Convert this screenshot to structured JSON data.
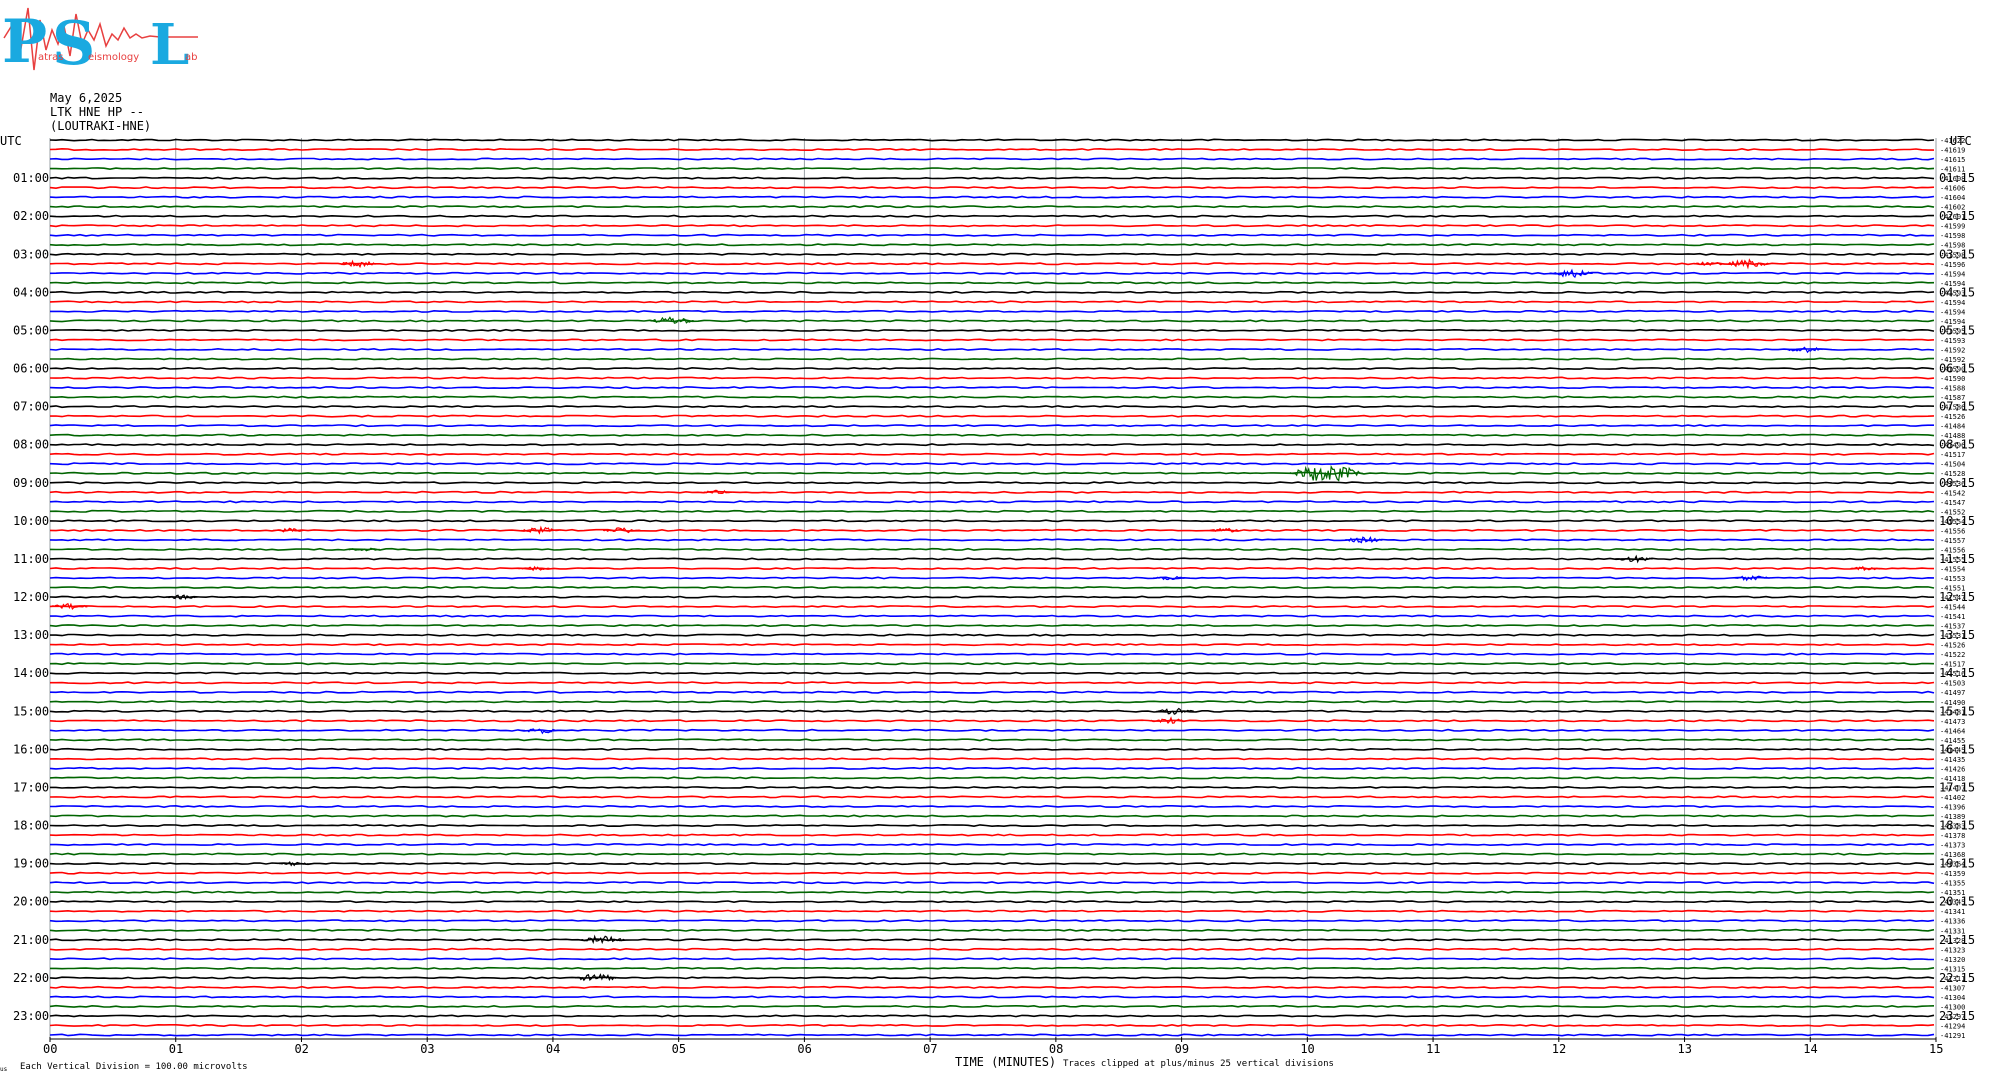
{
  "header": {
    "logo": {
      "name": "Patras Seismology Lab",
      "letters": [
        "P",
        "S",
        "L"
      ],
      "caption_words": [
        "atras",
        "eismology",
        "ab"
      ]
    },
    "date": "May 6,2025",
    "channel": "LTK HNE HP --",
    "station": "(LOUTRAKI-HNE)"
  },
  "chart_data": {
    "type": "line",
    "title": "",
    "xlabel": "TIME (MINUTES)",
    "x_ticks": [
      "00",
      "01",
      "02",
      "03",
      "04",
      "05",
      "06",
      "07",
      "08",
      "09",
      "10",
      "11",
      "12",
      "13",
      "14",
      "15"
    ],
    "xlim": [
      0,
      15
    ],
    "left_axis_label": "UTC",
    "right_axis_label": "UTC",
    "left_hour_labels": [
      "01:00",
      "02:00",
      "03:00",
      "04:00",
      "05:00",
      "06:00",
      "07:00",
      "08:00",
      "09:00",
      "10:00",
      "11:00",
      "12:00",
      "13:00",
      "14:00",
      "15:00",
      "16:00",
      "17:00",
      "18:00",
      "19:00",
      "20:00",
      "21:00",
      "22:00",
      "23:00"
    ],
    "right_hour_labels": [
      "01:15",
      "02:15",
      "03:15",
      "04:15",
      "05:15",
      "06:15",
      "07:15",
      "08:15",
      "09:15",
      "10:15",
      "11:15",
      "12:15",
      "13:15",
      "14:15",
      "15:15",
      "16:15",
      "17:15",
      "18:15",
      "19:15",
      "20:15",
      "21:15",
      "22:15",
      "23:15"
    ],
    "trace_color_cycle": [
      "#000000",
      "#ff0000",
      "#0000ff",
      "#006400"
    ],
    "trace_offsets": [
      "-41622",
      "-41619",
      "-41615",
      "-41611",
      "-41608",
      "-41606",
      "-41604",
      "-41602",
      "-41601",
      "-41599",
      "-41598",
      "-41598",
      "-41598",
      "-41596",
      "-41594",
      "-41594",
      "-41593",
      "-41594",
      "-41594",
      "-41594",
      "-41595",
      "-41593",
      "-41592",
      "-41592",
      "-41590",
      "-41590",
      "-41588",
      "-41587",
      "-41586",
      "-41526",
      "-41484",
      "-41488",
      "-41496",
      "-41517",
      "-41504",
      "-41528",
      "-41536",
      "-41542",
      "-41547",
      "-41552",
      "-41554",
      "-41556",
      "-41557",
      "-41556",
      "-41555",
      "-41554",
      "-41553",
      "-41551",
      "-41547",
      "-41544",
      "-41541",
      "-41537",
      "-41531",
      "-41526",
      "-41522",
      "-41517",
      "-41516",
      "-41503",
      "-41497",
      "-41490",
      "-41481",
      "-41473",
      "-41464",
      "-41455",
      "-41445",
      "-41435",
      "-41426",
      "-41418",
      "-41407",
      "-41402",
      "-41396",
      "-41389",
      "-41383",
      "-41378",
      "-41373",
      "-41368",
      "-41364",
      "-41359",
      "-41355",
      "-41351",
      "-41345",
      "-41341",
      "-41336",
      "-41331",
      "-41328",
      "-41323",
      "-41320",
      "-41315",
      "-41311",
      "-41307",
      "-41304",
      "-41300",
      "-41297",
      "-41294",
      "-41291"
    ],
    "events": [
      {
        "trace": 13,
        "minute": 2.45,
        "amp": 3
      },
      {
        "trace": 14,
        "minute": 12.1,
        "amp": 4
      },
      {
        "trace": 13,
        "minute": 13.5,
        "amp": 4
      },
      {
        "trace": 13,
        "minute": 13.2,
        "amp": 2
      },
      {
        "trace": 19,
        "minute": 4.95,
        "amp": 4
      },
      {
        "trace": 22,
        "minute": 13.95,
        "amp": 3
      },
      {
        "trace": 35,
        "minute": 10.15,
        "amp": 9
      },
      {
        "trace": 37,
        "minute": 5.3,
        "amp": 2
      },
      {
        "trace": 41,
        "minute": 1.9,
        "amp": 2
      },
      {
        "trace": 41,
        "minute": 3.9,
        "amp": 3
      },
      {
        "trace": 41,
        "minute": 4.55,
        "amp": 3
      },
      {
        "trace": 41,
        "minute": 9.35,
        "amp": 2
      },
      {
        "trace": 42,
        "minute": 10.45,
        "amp": 3
      },
      {
        "trace": 43,
        "minute": 2.5,
        "amp": 2
      },
      {
        "trace": 44,
        "minute": 12.6,
        "amp": 3
      },
      {
        "trace": 45,
        "minute": 3.85,
        "amp": 2
      },
      {
        "trace": 45,
        "minute": 14.45,
        "amp": 2
      },
      {
        "trace": 46,
        "minute": 13.55,
        "amp": 3
      },
      {
        "trace": 46,
        "minute": 8.9,
        "amp": 2
      },
      {
        "trace": 48,
        "minute": 1.05,
        "amp": 2
      },
      {
        "trace": 49,
        "minute": 0.15,
        "amp": 3
      },
      {
        "trace": 60,
        "minute": 8.95,
        "amp": 3
      },
      {
        "trace": 61,
        "minute": 8.9,
        "amp": 3
      },
      {
        "trace": 62,
        "minute": 3.9,
        "amp": 3
      },
      {
        "trace": 76,
        "minute": 1.95,
        "amp": 2
      },
      {
        "trace": 84,
        "minute": 4.4,
        "amp": 4
      },
      {
        "trace": 88,
        "minute": 4.35,
        "amp": 4
      }
    ]
  },
  "footer": {
    "units_note": "Each Vertical Division = 100.00 microvolts",
    "clip_note": "Traces clipped at plus/minus 25 vertical divisions",
    "corner_mark": "us"
  }
}
